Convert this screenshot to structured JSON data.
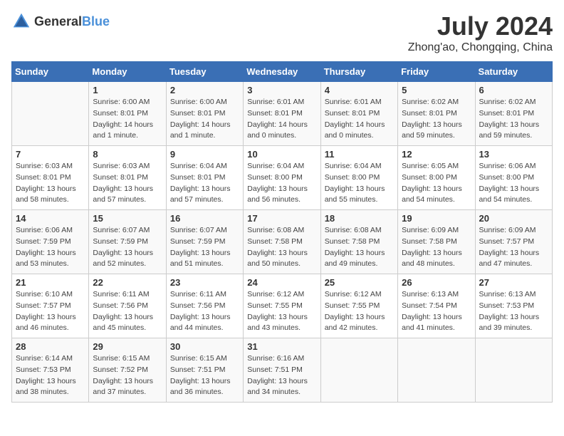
{
  "logo": {
    "text_general": "General",
    "text_blue": "Blue"
  },
  "title": "July 2024",
  "subtitle": "Zhong'ao, Chongqing, China",
  "days_of_week": [
    "Sunday",
    "Monday",
    "Tuesday",
    "Wednesday",
    "Thursday",
    "Friday",
    "Saturday"
  ],
  "weeks": [
    [
      {
        "day": "",
        "info": ""
      },
      {
        "day": "1",
        "info": "Sunrise: 6:00 AM\nSunset: 8:01 PM\nDaylight: 14 hours\nand 1 minute."
      },
      {
        "day": "2",
        "info": "Sunrise: 6:00 AM\nSunset: 8:01 PM\nDaylight: 14 hours\nand 1 minute."
      },
      {
        "day": "3",
        "info": "Sunrise: 6:01 AM\nSunset: 8:01 PM\nDaylight: 14 hours\nand 0 minutes."
      },
      {
        "day": "4",
        "info": "Sunrise: 6:01 AM\nSunset: 8:01 PM\nDaylight: 14 hours\nand 0 minutes."
      },
      {
        "day": "5",
        "info": "Sunrise: 6:02 AM\nSunset: 8:01 PM\nDaylight: 13 hours\nand 59 minutes."
      },
      {
        "day": "6",
        "info": "Sunrise: 6:02 AM\nSunset: 8:01 PM\nDaylight: 13 hours\nand 59 minutes."
      }
    ],
    [
      {
        "day": "7",
        "info": "Sunrise: 6:03 AM\nSunset: 8:01 PM\nDaylight: 13 hours\nand 58 minutes."
      },
      {
        "day": "8",
        "info": "Sunrise: 6:03 AM\nSunset: 8:01 PM\nDaylight: 13 hours\nand 57 minutes."
      },
      {
        "day": "9",
        "info": "Sunrise: 6:04 AM\nSunset: 8:01 PM\nDaylight: 13 hours\nand 57 minutes."
      },
      {
        "day": "10",
        "info": "Sunrise: 6:04 AM\nSunset: 8:00 PM\nDaylight: 13 hours\nand 56 minutes."
      },
      {
        "day": "11",
        "info": "Sunrise: 6:04 AM\nSunset: 8:00 PM\nDaylight: 13 hours\nand 55 minutes."
      },
      {
        "day": "12",
        "info": "Sunrise: 6:05 AM\nSunset: 8:00 PM\nDaylight: 13 hours\nand 54 minutes."
      },
      {
        "day": "13",
        "info": "Sunrise: 6:06 AM\nSunset: 8:00 PM\nDaylight: 13 hours\nand 54 minutes."
      }
    ],
    [
      {
        "day": "14",
        "info": "Sunrise: 6:06 AM\nSunset: 7:59 PM\nDaylight: 13 hours\nand 53 minutes."
      },
      {
        "day": "15",
        "info": "Sunrise: 6:07 AM\nSunset: 7:59 PM\nDaylight: 13 hours\nand 52 minutes."
      },
      {
        "day": "16",
        "info": "Sunrise: 6:07 AM\nSunset: 7:59 PM\nDaylight: 13 hours\nand 51 minutes."
      },
      {
        "day": "17",
        "info": "Sunrise: 6:08 AM\nSunset: 7:58 PM\nDaylight: 13 hours\nand 50 minutes."
      },
      {
        "day": "18",
        "info": "Sunrise: 6:08 AM\nSunset: 7:58 PM\nDaylight: 13 hours\nand 49 minutes."
      },
      {
        "day": "19",
        "info": "Sunrise: 6:09 AM\nSunset: 7:58 PM\nDaylight: 13 hours\nand 48 minutes."
      },
      {
        "day": "20",
        "info": "Sunrise: 6:09 AM\nSunset: 7:57 PM\nDaylight: 13 hours\nand 47 minutes."
      }
    ],
    [
      {
        "day": "21",
        "info": "Sunrise: 6:10 AM\nSunset: 7:57 PM\nDaylight: 13 hours\nand 46 minutes."
      },
      {
        "day": "22",
        "info": "Sunrise: 6:11 AM\nSunset: 7:56 PM\nDaylight: 13 hours\nand 45 minutes."
      },
      {
        "day": "23",
        "info": "Sunrise: 6:11 AM\nSunset: 7:56 PM\nDaylight: 13 hours\nand 44 minutes."
      },
      {
        "day": "24",
        "info": "Sunrise: 6:12 AM\nSunset: 7:55 PM\nDaylight: 13 hours\nand 43 minutes."
      },
      {
        "day": "25",
        "info": "Sunrise: 6:12 AM\nSunset: 7:55 PM\nDaylight: 13 hours\nand 42 minutes."
      },
      {
        "day": "26",
        "info": "Sunrise: 6:13 AM\nSunset: 7:54 PM\nDaylight: 13 hours\nand 41 minutes."
      },
      {
        "day": "27",
        "info": "Sunrise: 6:13 AM\nSunset: 7:53 PM\nDaylight: 13 hours\nand 39 minutes."
      }
    ],
    [
      {
        "day": "28",
        "info": "Sunrise: 6:14 AM\nSunset: 7:53 PM\nDaylight: 13 hours\nand 38 minutes."
      },
      {
        "day": "29",
        "info": "Sunrise: 6:15 AM\nSunset: 7:52 PM\nDaylight: 13 hours\nand 37 minutes."
      },
      {
        "day": "30",
        "info": "Sunrise: 6:15 AM\nSunset: 7:51 PM\nDaylight: 13 hours\nand 36 minutes."
      },
      {
        "day": "31",
        "info": "Sunrise: 6:16 AM\nSunset: 7:51 PM\nDaylight: 13 hours\nand 34 minutes."
      },
      {
        "day": "",
        "info": ""
      },
      {
        "day": "",
        "info": ""
      },
      {
        "day": "",
        "info": ""
      }
    ]
  ]
}
